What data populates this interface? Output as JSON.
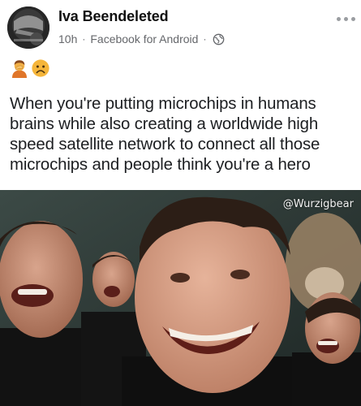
{
  "post": {
    "author": {
      "name": "Iva Beendeleted"
    },
    "meta": {
      "time": "10h",
      "separator": "·",
      "source": "Facebook for Android",
      "privacy_icon": "globe-icon"
    },
    "emojis": [
      "person-facepalm-emoji",
      "frowning-face-emoji"
    ],
    "text": "When you're putting microchips in humans brains while also creating a worldwide high speed satellite network to connect all those microchips and people think you're a hero",
    "image": {
      "watermark": "@Wurzigbear"
    }
  },
  "colors": {
    "meta_gray": "#65676b",
    "text": "#1c1e21",
    "emoji_yellow": "#f5b53a",
    "image_background": "#2b3a3a"
  }
}
